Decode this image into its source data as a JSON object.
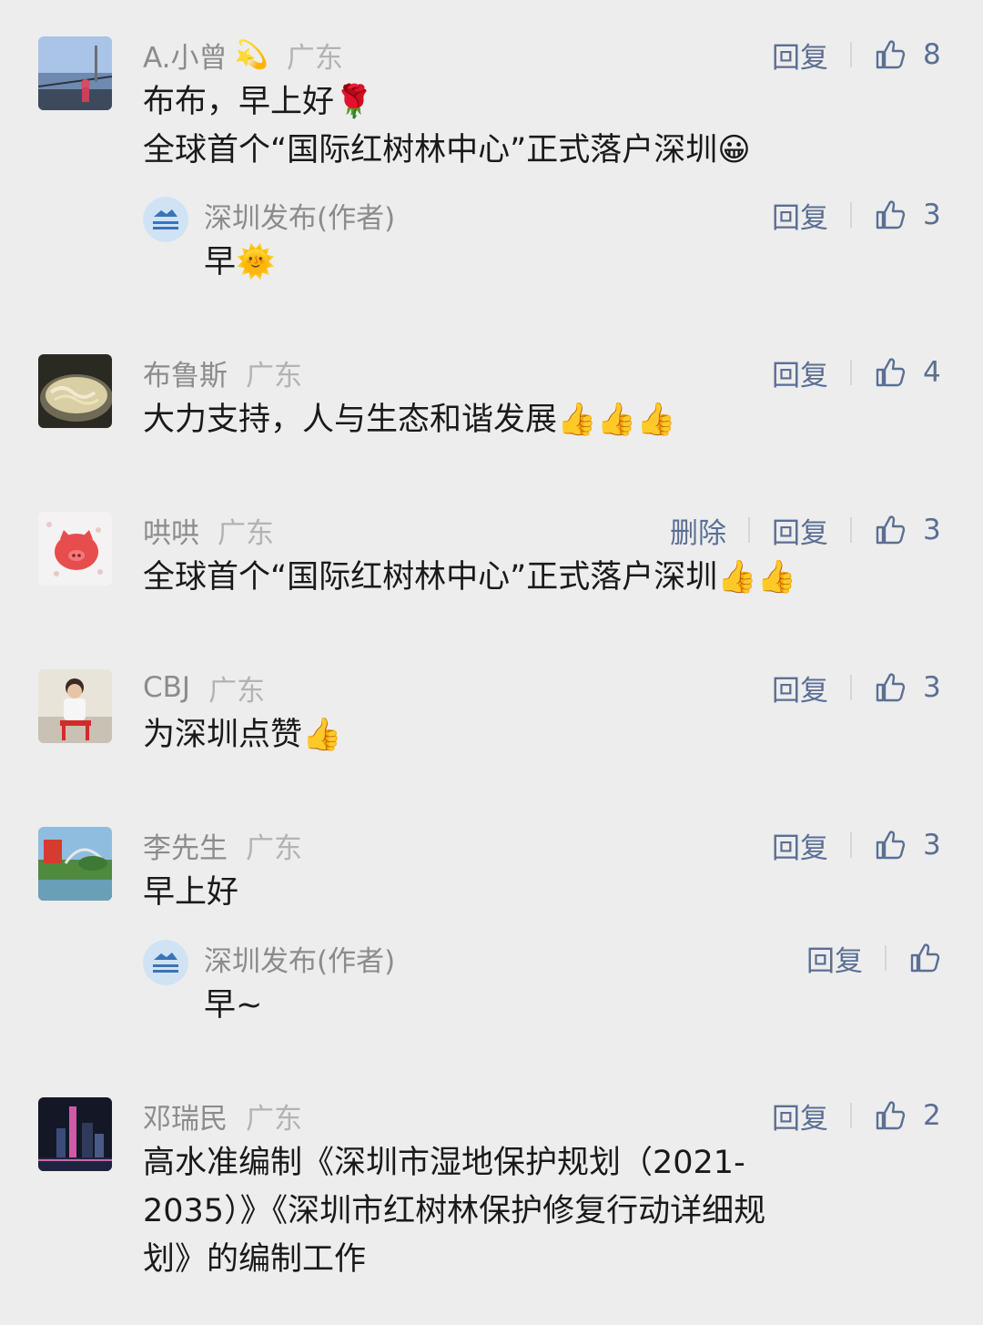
{
  "labels": {
    "reply": "回复",
    "delete": "删除"
  },
  "comments": [
    {
      "name": "A.小曾",
      "name_emoji": "💫",
      "location": "广东",
      "likes": "8",
      "text_line1": "布布，早上好🌹",
      "text_line2": "全球首个“国际红树林中心”正式落户深圳😀",
      "reply": {
        "name": "深圳发布(作者)",
        "likes": "3",
        "text": "早🌞"
      }
    },
    {
      "name": "布鲁斯",
      "location": "广东",
      "likes": "4",
      "text": "大力支持，人与生态和谐发展👍👍👍"
    },
    {
      "name": "哄哄",
      "location": "广东",
      "likes": "3",
      "text": "全球首个“国际红树林中心”正式落户深圳👍👍"
    },
    {
      "name": "CBJ",
      "location": "广东",
      "likes": "3",
      "text": "为深圳点赞👍"
    },
    {
      "name": "李先生",
      "location": "广东",
      "likes": "3",
      "text": "早上好",
      "reply": {
        "name": "深圳发布(作者)",
        "likes": "",
        "text": "早~"
      }
    },
    {
      "name": "邓瑞民",
      "location": "广东",
      "likes": "2",
      "text_lines": [
        "高水准编制《深圳市湿地保护规划（2021-",
        "2035）》《深圳市红树林保护修复行动详细规",
        "划》的编制工作"
      ]
    }
  ],
  "colors": {
    "background": "#ededed",
    "name": "#8c8c8c",
    "action": "#5b6f94",
    "text": "#1a1a1a"
  }
}
